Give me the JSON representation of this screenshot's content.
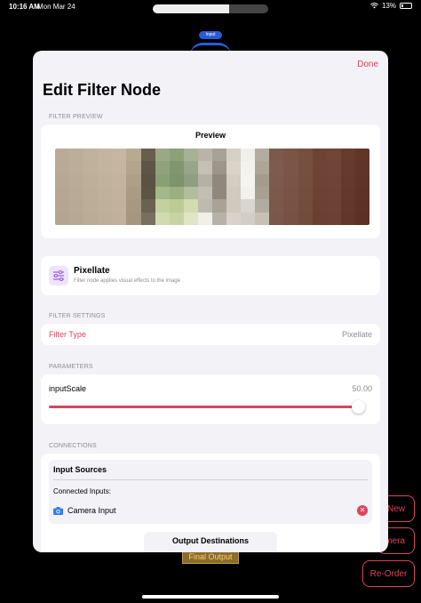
{
  "status_bar": {
    "time": "10:16 AM",
    "date": "Mon Mar 24",
    "battery": "13%",
    "icons": [
      "wifi-icon",
      "battery-icon"
    ]
  },
  "background": {
    "input_node_label": "Input",
    "final_output_label": "Final Output",
    "buttons": {
      "new": "New",
      "camera": "mera",
      "reorder": "Re-Order"
    }
  },
  "sheet": {
    "done_label": "Done",
    "title": "Edit Filter Node",
    "preview": {
      "section_header": "FILTER PREVIEW",
      "title": "Preview"
    },
    "filter_info": {
      "icon": "sliders-icon",
      "name": "Pixellate",
      "description": "Filter node applies visual effects to the image"
    },
    "filter_settings": {
      "section_header": "FILTER SETTINGS",
      "type_label": "Filter Type",
      "type_value": "Pixellate"
    },
    "parameters": {
      "section_header": "PARAMETERS",
      "name": "inputScale",
      "value": "50.00",
      "slider_fraction": 0.98
    },
    "connections": {
      "section_header": "CONNECTIONS",
      "input_sources_title": "Input Sources",
      "connected_inputs_label": "Connected Inputs:",
      "inputs": [
        {
          "label": "Camera Input",
          "icon": "camera-icon"
        }
      ],
      "remove_icon": "remove-icon",
      "output_destinations_title": "Output Destinations"
    }
  },
  "colors": {
    "accent": "#e0425b",
    "slider": "#d0495e",
    "sheet_bg": "#f2f2f7",
    "secondary_text": "#8e8e93",
    "input_node": "#2a5bd7"
  },
  "preview_mosaic_colors": [
    [
      "#b9ab98",
      "#bdae9a",
      "#c1b29e",
      "#c4b5a0",
      "#c7b7a2",
      "#b7a992",
      "#675e4d",
      "#9aa886",
      "#8ea07a",
      "#a7b195",
      "#b8b4a6",
      "#a8a196",
      "#d6d0c5",
      "#f1efea",
      "#b3aca0",
      "#7b5a4b",
      "#7a5546",
      "#774f40",
      "#6c4334",
      "#6f4637",
      "#653c2d",
      "#5f3627"
    ],
    [
      "#b8aa97",
      "#bcad99",
      "#c0b19d",
      "#c3b49f",
      "#c6b6a1",
      "#b3a48d",
      "#5d5545",
      "#8fa27b",
      "#7f9670",
      "#97a58a",
      "#c4c0b3",
      "#9c958a",
      "#d9d3c8",
      "#f4f2ee",
      "#ada596",
      "#7d5c4d",
      "#7b5647",
      "#76503f",
      "#6d4435",
      "#6e4536",
      "#643b2c",
      "#5e3526"
    ],
    [
      "#b6a895",
      "#baab97",
      "#beaf9b",
      "#c1b29d",
      "#c4b49f",
      "#aea088",
      "#5a5243",
      "#88a074",
      "#7b946b",
      "#8e9e82",
      "#b4b1a5",
      "#8f887c",
      "#d3cdc2",
      "#f6f4f0",
      "#a39c8d",
      "#7c5b4c",
      "#7a5546",
      "#754f3e",
      "#6c4334",
      "#6d4435",
      "#633a2b",
      "#5d3425"
    ],
    [
      "#b5a794",
      "#b9aa96",
      "#bdae9a",
      "#c0b19c",
      "#c3b39e",
      "#aa9c84",
      "#5c5444",
      "#a4b88a",
      "#9ab081",
      "#b0be9d",
      "#c2bfb2",
      "#8f887c",
      "#d0cabf",
      "#f3f1ed",
      "#a8a091",
      "#7b5a4b",
      "#795445",
      "#744e3d",
      "#6b4233",
      "#6c4334",
      "#62392a",
      "#5c3324"
    ],
    [
      "#b4a693",
      "#b8a995",
      "#bcad99",
      "#bfb09b",
      "#c2b29d",
      "#a79981",
      "#6a6250",
      "#c4d09e",
      "#bccb95",
      "#d4dbb2",
      "#bdbab0",
      "#a9a396",
      "#cfc9be",
      "#d9d6d0",
      "#b2ab9f",
      "#7a594a",
      "#785344",
      "#734d3c",
      "#6a4132",
      "#6b4233",
      "#61382a",
      "#5b3223"
    ],
    [
      "#b3a592",
      "#b7a894",
      "#bbac98",
      "#beaf9a",
      "#c1b19c",
      "#a5977f",
      "#77705e",
      "#d2dab0",
      "#c8d2a4",
      "#e0e5c6",
      "#f0efe8",
      "#b8b2a6",
      "#d8d3ca",
      "#d2cec7",
      "#c6c0b5",
      "#79584a",
      "#775243",
      "#724c3b",
      "#694031",
      "#6a4132",
      "#603729",
      "#5a3122"
    ]
  ]
}
